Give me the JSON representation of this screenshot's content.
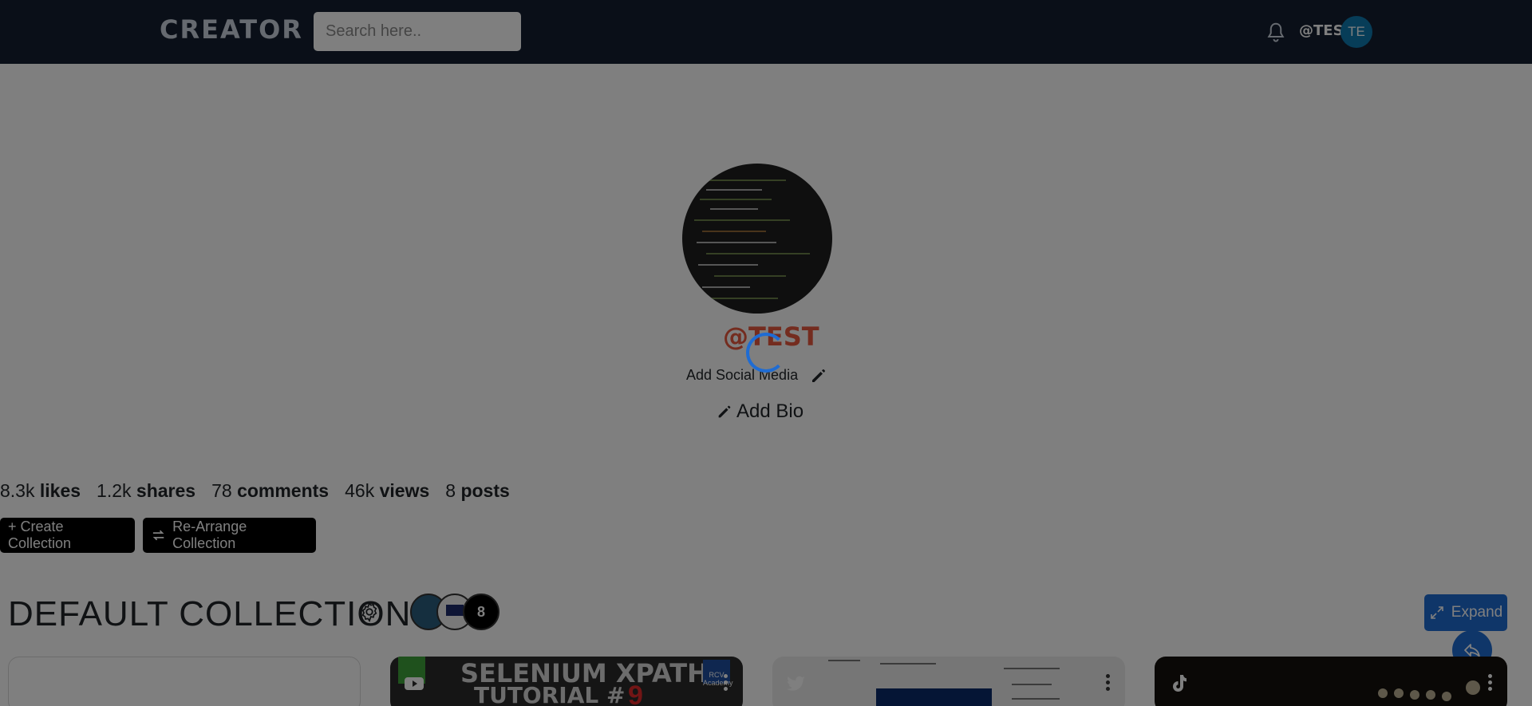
{
  "header": {
    "brand": "CREATOR",
    "search_placeholder": "Search here..",
    "username": "@TEST",
    "avatar_initials": "TE"
  },
  "profile": {
    "name": "@TEST",
    "add_social_label": "Add Social Media",
    "add_bio_label": "Add Bio"
  },
  "stats": [
    {
      "value": "8.3k",
      "label": "likes"
    },
    {
      "value": "1.2k",
      "label": "shares"
    },
    {
      "value": "78",
      "label": "comments"
    },
    {
      "value": "46k",
      "label": "views"
    },
    {
      "value": "8",
      "label": "posts"
    }
  ],
  "actions": {
    "create_collection": "+ Create Collection",
    "rearrange_collection": "Re-Arrange Collection"
  },
  "collection": {
    "title": "DEFAULT COLLECTION",
    "thumb_count": "8",
    "expand_label": "Expand"
  },
  "cards": [
    {
      "platform": "blank"
    },
    {
      "platform": "youtube-icon",
      "title": "SELENIUM XPATH",
      "subtitle": "TUTORIAL #",
      "number": "9",
      "badge": "RCV Academy"
    },
    {
      "platform": "twitter-icon"
    },
    {
      "platform": "tiktok-icon"
    }
  ],
  "colors": {
    "header_bg": "#141e30",
    "accent": "#1f6cd3",
    "name": "#e8593e",
    "overlay": "rgba(0,0,0,0.5)"
  }
}
